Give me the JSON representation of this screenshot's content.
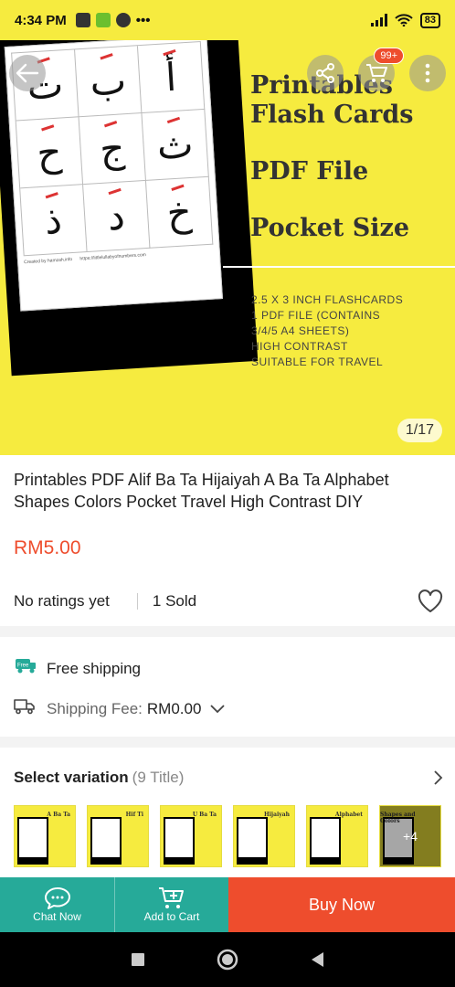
{
  "status_bar": {
    "time": "4:34 PM",
    "battery": "83",
    "dots": "•••"
  },
  "hero": {
    "arabic_letters": [
      "أ",
      "ب",
      "ت",
      "ث",
      "ج",
      "ح",
      "خ",
      "د",
      "ذ"
    ],
    "sheet_footer_left": "Created by hamzah.info",
    "sheet_footer_right": "https://littlelullabyofnumbers.com",
    "line1a": "Printables",
    "line1b": "Flash Cards",
    "line2": "PDF File",
    "line3": "Pocket Size",
    "features": [
      "2.5 X 3 INCH FLASHCARDS",
      "1 PDF FILE (CONTAINS",
      "3/4/5 A4 SHEETS)",
      "HIGH CONTRAST",
      "SUITABLE FOR TRAVEL"
    ],
    "cart_badge": "99+",
    "page_indicator": "1/17"
  },
  "product": {
    "title": "Printables PDF Alif Ba Ta Hijaiyah A Ba Ta Alphabet Shapes Colors Pocket Travel High Contrast DIY",
    "price": "RM5.00",
    "ratings": "No ratings yet",
    "sold": "1 Sold"
  },
  "shipping": {
    "free_badge": "Free",
    "free_label": "Free shipping",
    "fee_label": "Shipping Fee:",
    "fee_value": "RM0.00"
  },
  "variation": {
    "label": "Select variation",
    "count": "(9 Title)",
    "thumbs": [
      "A Ba Ta",
      "Hif Ti",
      "U Ba Ta",
      "Hijaiyah",
      "Alphabet",
      "Shapes and Colors"
    ],
    "more": "+4"
  },
  "bottom_bar": {
    "chat": "Chat Now",
    "cart": "Add to Cart",
    "buy": "Buy Now"
  },
  "colors": {
    "accent": "#ee4d2d",
    "teal": "#26aa99",
    "hero_bg": "#f6eb3f"
  }
}
